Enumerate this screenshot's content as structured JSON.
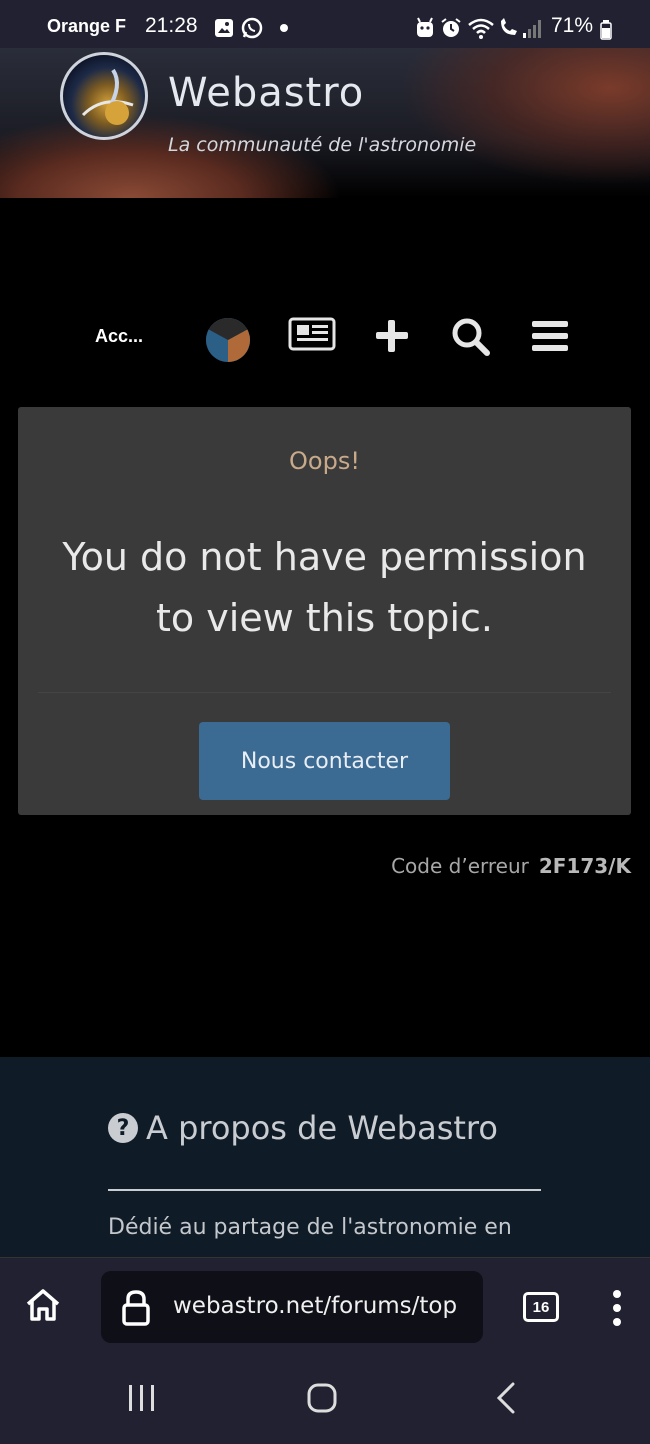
{
  "status_bar": {
    "carrier": "Orange F",
    "time": "21:28",
    "battery": "71%"
  },
  "header": {
    "site_name": "Webastro",
    "tagline": "La communauté de l'astronomie"
  },
  "nav": {
    "account_label": "Acc..."
  },
  "error_card": {
    "heading": "Oops!",
    "message": "You do not have permission to view this topic.",
    "button_label": "Nous contacter"
  },
  "error_code": {
    "label": "Code d’erreur",
    "value": "2F173/K"
  },
  "footer": {
    "title": "A propos de Webastro",
    "text": "Dédié au partage de l'astronomie en"
  },
  "browser": {
    "url": "webastro.net/forums/top",
    "tab_count": "16"
  },
  "colors": {
    "accent_button": "#3b6a92",
    "card_bg": "#3a3a3a",
    "footer_bg": "#0f1c27",
    "oops_text": "#c8a98a"
  }
}
